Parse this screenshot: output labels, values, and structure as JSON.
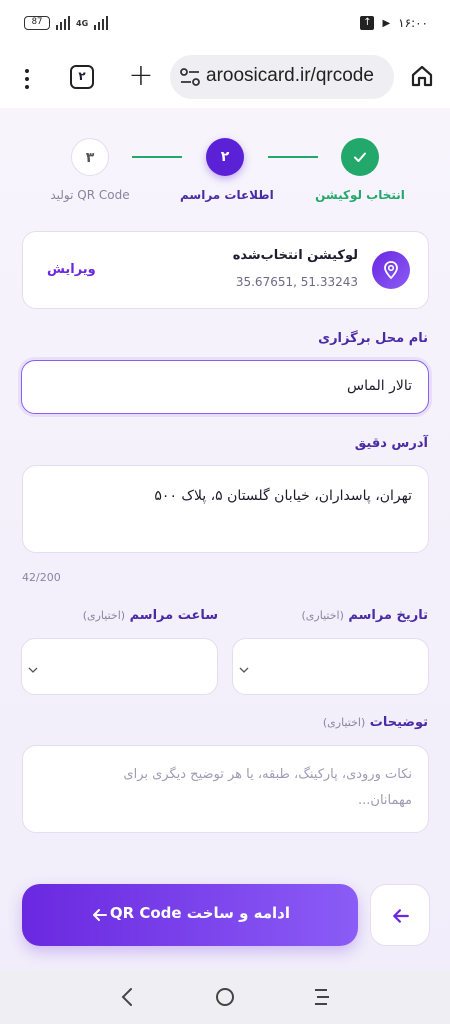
{
  "status_bar": {
    "battery": "87",
    "network": "4G",
    "time": "۱۶:۰۰"
  },
  "browser": {
    "tab_count": "۲",
    "url": "aroosicard.ir/qrcode",
    "icons": [
      "menu-dots-icon",
      "tabs-icon",
      "plus-icon",
      "site-settings-icon",
      "home-icon"
    ]
  },
  "stepper": {
    "steps": [
      {
        "number": "",
        "label": "انتخاب لوکیشن",
        "state": "done"
      },
      {
        "number": "۲",
        "label": "اطلاعات مراسم",
        "state": "active"
      },
      {
        "number": "۳",
        "label": "تولید QR Code",
        "state": "pending"
      }
    ]
  },
  "location_card": {
    "title": "لوکیشن انتخاب‌شده",
    "coords": "35.67651, 51.33243",
    "edit_label": "ویرایش"
  },
  "venue": {
    "label": "نام محل برگزاری",
    "value": "تالار الماس"
  },
  "address": {
    "label": "آدرس دقیق",
    "value": "تهران، پاسداران، خیابان گلستان ۵، پلاک ۵۰۰",
    "counter": "42/200"
  },
  "date": {
    "label": "تاریخ مراسم",
    "optional": "(اختیاری)"
  },
  "time": {
    "label": "ساعت مراسم",
    "optional": "(اختیاری)"
  },
  "notes": {
    "label": "توضیحات",
    "optional": "(اختیاری)",
    "placeholder": "نکات ورودی، پارکینگ، طبقه، یا هر توضیح دیگری برای مهمانان..."
  },
  "actions": {
    "continue_label": "ادامه و ساخت QR Code"
  },
  "colors": {
    "primary": "#6a28e0",
    "success": "#23a86b",
    "label_purple": "#4a2aa5"
  }
}
